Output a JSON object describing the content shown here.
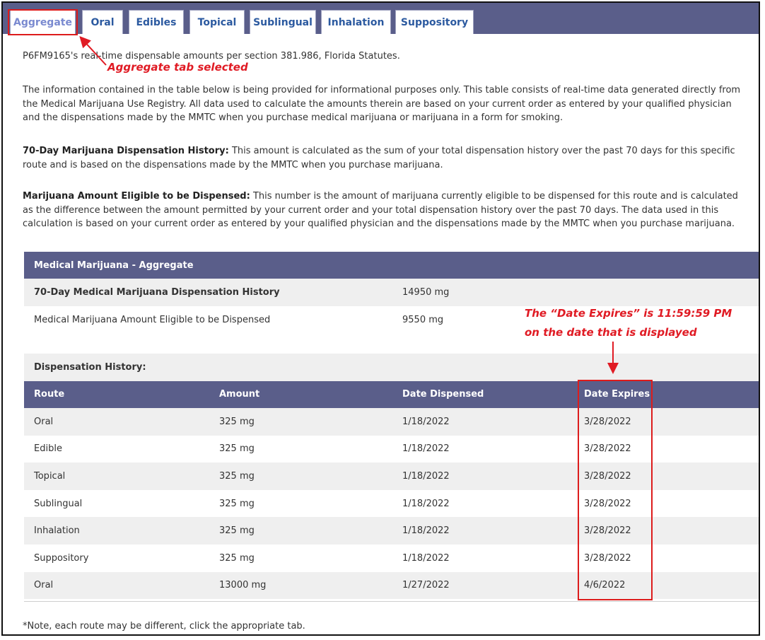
{
  "tabs": [
    {
      "label": "Aggregate",
      "active": true
    },
    {
      "label": "Oral"
    },
    {
      "label": "Edibles"
    },
    {
      "label": "Topical"
    },
    {
      "label": "Sublingual"
    },
    {
      "label": "Inhalation"
    },
    {
      "label": "Suppository"
    }
  ],
  "intro": "P6FM9165's real-time dispensable amounts per section 381.986, Florida Statutes.",
  "annotations": {
    "tab": "Aggregate tab selected",
    "expires_line1": "The “Date Expires” is 11:59:59 PM",
    "expires_line2": "on the date that is displayed"
  },
  "paragraphs": {
    "p1": "The information contained in the table below is being provided for informational purposes only. This table consists of real-time data generated directly from the Medical Marijuana Use Registry. All data used to calculate the amounts therein are based on your current order as entered by your qualified physician and the dispensations made by the MMTC when you purchase medical marijuana or marijuana in a form for smoking.",
    "p2_bold": "70-Day Marijuana Dispensation History:",
    "p2_text": " This amount is calculated as the sum of your total dispensation history over the past 70 days for this specific route and is based on the dispensations made by the MMTC when you purchase marijuana.",
    "p3_bold": "Marijuana Amount Eligible to be Dispensed:",
    "p3_text": " This number is the amount of marijuana currently eligible to be dispensed for this route and is calculated as the difference between the amount permitted by your current order and your total dispensation history over the past 70 days. The data used in this calculation is based on your current order as entered by your qualified physician and the dispensations made by the MMTC when you purchase marijuana."
  },
  "summary": {
    "header": "Medical Marijuana - Aggregate",
    "history_label": "70-Day Medical Marijuana Dispensation History",
    "history_value": "14950 mg",
    "eligible_label": "Medical Marijuana Amount Eligible to be Dispensed",
    "eligible_value": "9550 mg"
  },
  "dispensation": {
    "label": "Dispensation History:",
    "columns": {
      "route": "Route",
      "amount": "Amount",
      "dispensed": "Date Dispensed",
      "expires": "Date Expires"
    },
    "rows": [
      {
        "route": "Oral",
        "amount": "325 mg",
        "dispensed": "1/18/2022",
        "expires": "3/28/2022"
      },
      {
        "route": "Edible",
        "amount": "325 mg",
        "dispensed": "1/18/2022",
        "expires": "3/28/2022"
      },
      {
        "route": "Topical",
        "amount": "325 mg",
        "dispensed": "1/18/2022",
        "expires": "3/28/2022"
      },
      {
        "route": "Sublingual",
        "amount": "325 mg",
        "dispensed": "1/18/2022",
        "expires": "3/28/2022"
      },
      {
        "route": "Inhalation",
        "amount": "325 mg",
        "dispensed": "1/18/2022",
        "expires": "3/28/2022"
      },
      {
        "route": "Suppository",
        "amount": "325 mg",
        "dispensed": "1/18/2022",
        "expires": "3/28/2022"
      },
      {
        "route": "Oral",
        "amount": "13000 mg",
        "dispensed": "1/27/2022",
        "expires": "4/6/2022"
      }
    ]
  },
  "note": "*Note, each route may be different, click the appropriate tab.",
  "colors": {
    "header": "#5a5e8a",
    "tab_text": "#2c5aa0",
    "annotation": "#e01b24",
    "row_shade": "#efefef"
  }
}
